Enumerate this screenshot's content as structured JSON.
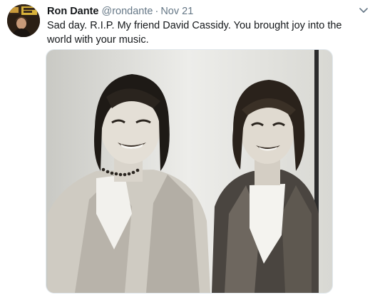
{
  "tweet": {
    "author_name": "Ron Dante",
    "handle": "@rondante",
    "separator": "·",
    "timestamp": "Nov 21",
    "text": "Sad day. R.I.P. My friend David Cassidy. You brought joy into the world with your music.",
    "more_menu_icon": "chevron-down-icon",
    "avatar_icon": "avatar",
    "media": {
      "type": "photo",
      "style": "black-and-white"
    }
  },
  "colors": {
    "name": "#14171a",
    "secondary": "#657786",
    "border": "#e1e8ed"
  }
}
